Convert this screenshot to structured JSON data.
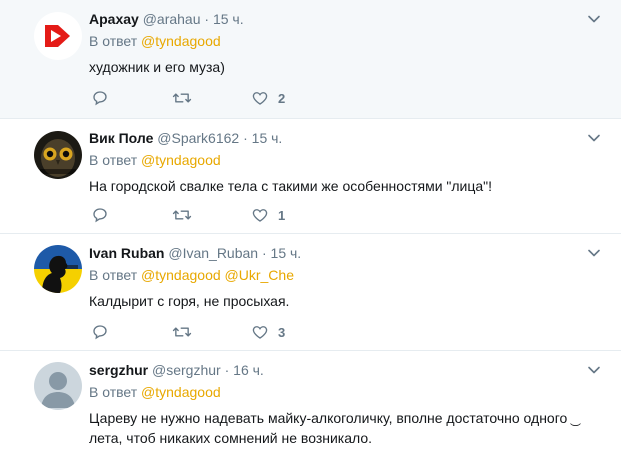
{
  "reply_prefix": "В ответ",
  "tweets": [
    {
      "name": "Арахау",
      "handle": "@arahau",
      "time": "15 ч.",
      "mentions": [
        "@tyndagood"
      ],
      "text": "художник и его муза)",
      "likes": "2",
      "avatar_icon": "red-play-logo",
      "avatar_color": "#e41b17"
    },
    {
      "name": "Вик Поле",
      "handle": "@Spark6162",
      "time": "15 ч.",
      "mentions": [
        "@tyndagood"
      ],
      "text": "На городской свалке тела с такими же особенностями \"лица\"!",
      "likes": "1",
      "avatar_icon": "owl-photo"
    },
    {
      "name": "Ivan Ruban",
      "handle": "@Ivan_Ruban",
      "time": "15 ч.",
      "mentions": [
        "@tyndagood",
        "@Ukr_Che"
      ],
      "text": "Калдырит с горя, не просыхая.",
      "likes": "3",
      "avatar_icon": "ukraine-flag-silhouette"
    },
    {
      "name": "sergzhur",
      "handle": "@sergzhur",
      "time": "16 ч.",
      "mentions": [
        "@tyndagood"
      ],
      "text": "Цареву не нужно надевать майку-алкоголичку, вполне достаточно одного ͜ лета, чтоб никаких сомнений не возникало.",
      "likes": "",
      "avatar_icon": "default-profile-silhouette"
    }
  ],
  "colors": {
    "mention": "#e8a800",
    "muted": "#657786",
    "divider": "#e6ecf0"
  }
}
